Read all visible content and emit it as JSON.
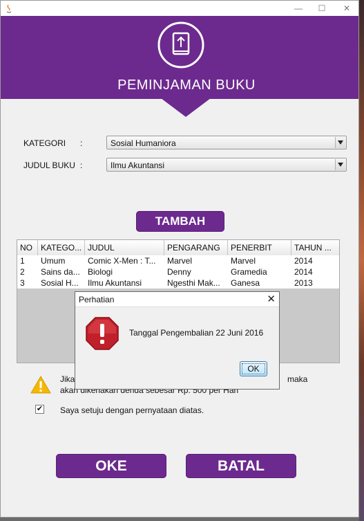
{
  "window": {
    "controls": {
      "minimize": "—",
      "maximize": "☐",
      "close": "✕"
    }
  },
  "header": {
    "title": "PEMINJAMAN BUKU"
  },
  "form": {
    "kategori_label": "KATEGORI",
    "judul_label": "JUDUL BUKU",
    "colon": ":",
    "kategori_value": "Sosial Humaniora",
    "judul_value": "Ilmu Akuntansi"
  },
  "buttons": {
    "tambah": "TAMBAH",
    "oke": "OKE",
    "batal": "BATAL"
  },
  "table": {
    "headers": [
      "NO",
      "KATEGO...",
      "JUDUL",
      "PENGARANG",
      "PENERBIT",
      "TAHUN ..."
    ],
    "rows": [
      [
        "1",
        "Umum",
        "Comic X-Men : T...",
        "Marvel",
        "Marvel",
        "2014"
      ],
      [
        "2",
        "Sains da...",
        "Biologi",
        "Denny",
        "Gramedia",
        "2014"
      ],
      [
        "3",
        "Sosial H...",
        "Ilmu Akuntansi",
        "Ngesthi Mak...",
        "Ganesa",
        "2013"
      ]
    ]
  },
  "notice": {
    "line1_start": "Jika",
    "line1_end": "maka",
    "line2": "akan dikenakan denda sebesar Rp. 500 per Hari"
  },
  "agreement": {
    "checked": true,
    "label": "Saya setuju dengan pernyataan diatas."
  },
  "dialog": {
    "title": "Perhatian",
    "close": "✕",
    "message": "Tanggal Pengembalian 22 Juni 2016",
    "ok": "OK"
  },
  "colors": {
    "brand_purple": "#6c2a8e",
    "error_red": "#c0202a",
    "warning_yellow": "#f5b800"
  }
}
